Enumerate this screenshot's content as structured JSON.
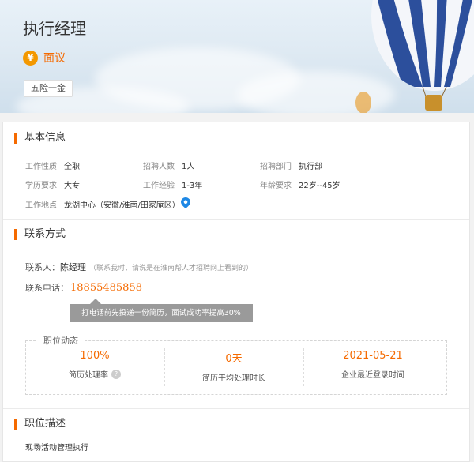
{
  "header": {
    "title": "执行经理",
    "salary": "面议",
    "salary_icon": "¥",
    "tag": "五险一金"
  },
  "basic": {
    "title": "基本信息",
    "fields": [
      {
        "label": "工作性质",
        "value": "全职"
      },
      {
        "label": "招聘人数",
        "value": "1人"
      },
      {
        "label": "招聘部门",
        "value": "执行部"
      },
      {
        "label": "学历要求",
        "value": "大专"
      },
      {
        "label": "工作经验",
        "value": "1-3年"
      },
      {
        "label": "年龄要求",
        "value": "22岁--45岁"
      },
      {
        "label": "工作地点",
        "value": "龙湖中心（安徽/淮南/田家庵区）"
      }
    ]
  },
  "contact": {
    "title": "联系方式",
    "person_label": "联系人：",
    "person": "陈经理",
    "note": "（联系我时，请说是在淮南帮人才招聘网上看到的）",
    "phone_label": "联系电话：",
    "phone": "18855485858",
    "tooltip": "打电话前先投递一份简历，面试成功率提高30%"
  },
  "dynamics": {
    "title": "职位动态",
    "items": [
      {
        "value": "100%",
        "label": "简历处理率"
      },
      {
        "value": "0天",
        "label": "简历平均处理时长"
      },
      {
        "value": "2021-05-21",
        "label": "企业最近登录时间"
      }
    ],
    "help_icon": "?"
  },
  "description": {
    "title": "职位描述",
    "text": "现场活动管理执行"
  },
  "colors": {
    "accent": "#f56a00",
    "yen": "#f39800"
  }
}
